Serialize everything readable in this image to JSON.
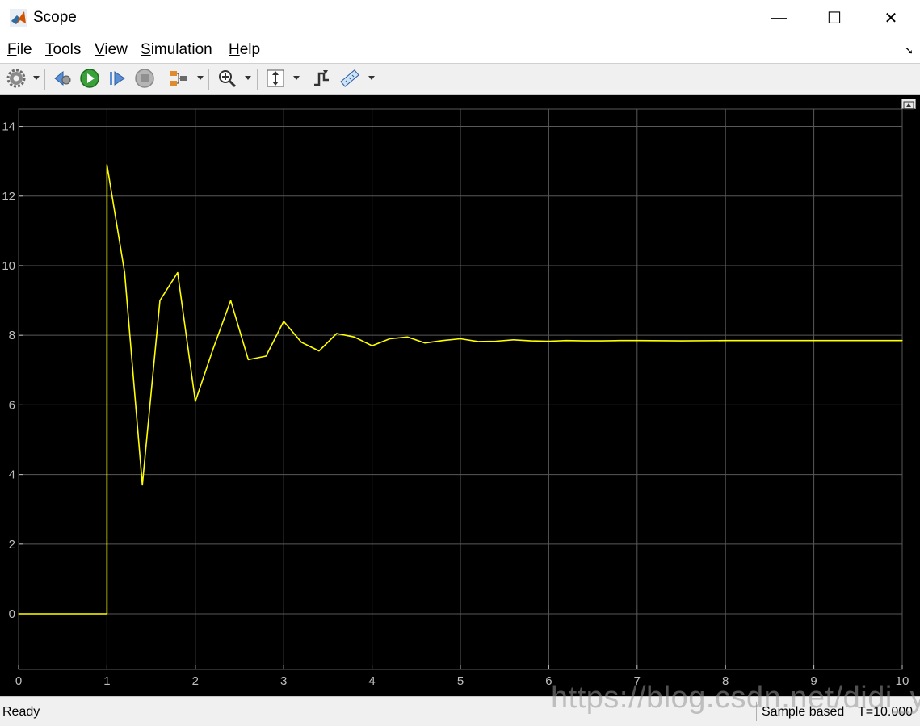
{
  "window": {
    "title": "Scope",
    "minimize_glyph": "—",
    "maximize_glyph": "☐",
    "close_glyph": "✕"
  },
  "menu": {
    "items": [
      {
        "accel": "F",
        "rest": "ile"
      },
      {
        "accel": "T",
        "rest": "ools"
      },
      {
        "accel": "V",
        "rest": "iew"
      },
      {
        "accel": "S",
        "rest": "imulation"
      },
      {
        "accel": "H",
        "rest": "elp"
      }
    ]
  },
  "toolbar": {
    "icons": [
      "gear-icon",
      "step-back-icon",
      "run-icon",
      "step-forward-icon",
      "stop-icon",
      "signal-selector-icon",
      "zoom-icon",
      "autoscale-icon",
      "triggers-icon",
      "measurement-icon"
    ]
  },
  "status": {
    "left": "Ready",
    "mode": "Sample based",
    "time": "T=10.000"
  },
  "watermark": "https://blog.csdn.net/didi_ya",
  "colors": {
    "plot_bg": "#000000",
    "grid": "#595959",
    "axis_text": "#bfbfbf",
    "trace": "#ffff00"
  },
  "chart_data": {
    "type": "line",
    "title": "",
    "xlabel": "",
    "ylabel": "",
    "xlim": [
      0,
      10
    ],
    "ylim": [
      -1.6,
      14.5
    ],
    "xticks": [
      0,
      1,
      2,
      3,
      4,
      5,
      6,
      7,
      8,
      9,
      10
    ],
    "yticks": [
      0,
      2,
      4,
      6,
      8,
      10,
      12,
      14
    ],
    "grid": true,
    "series": [
      {
        "x": [
          0,
          1,
          1,
          1.2,
          1.4,
          1.6,
          1.8,
          2.0,
          2.2,
          2.4,
          2.6,
          2.8,
          3.0,
          3.2,
          3.4,
          3.6,
          3.8,
          4.0,
          4.2,
          4.4,
          4.6,
          4.8,
          5.0,
          5.2,
          5.4,
          5.6,
          5.8,
          6.0,
          6.2,
          6.4,
          6.6,
          6.8,
          7.0,
          7.5,
          8.0,
          8.5,
          9.0,
          9.5,
          10.0
        ],
        "y": [
          0,
          0,
          12.9,
          9.8,
          3.7,
          9.0,
          9.8,
          6.1,
          7.6,
          9.0,
          7.3,
          7.4,
          8.4,
          7.8,
          7.55,
          8.05,
          7.95,
          7.7,
          7.9,
          7.95,
          7.78,
          7.85,
          7.9,
          7.82,
          7.83,
          7.87,
          7.84,
          7.83,
          7.85,
          7.84,
          7.84,
          7.85,
          7.85,
          7.84,
          7.85,
          7.85,
          7.85,
          7.85,
          7.85
        ]
      }
    ]
  }
}
